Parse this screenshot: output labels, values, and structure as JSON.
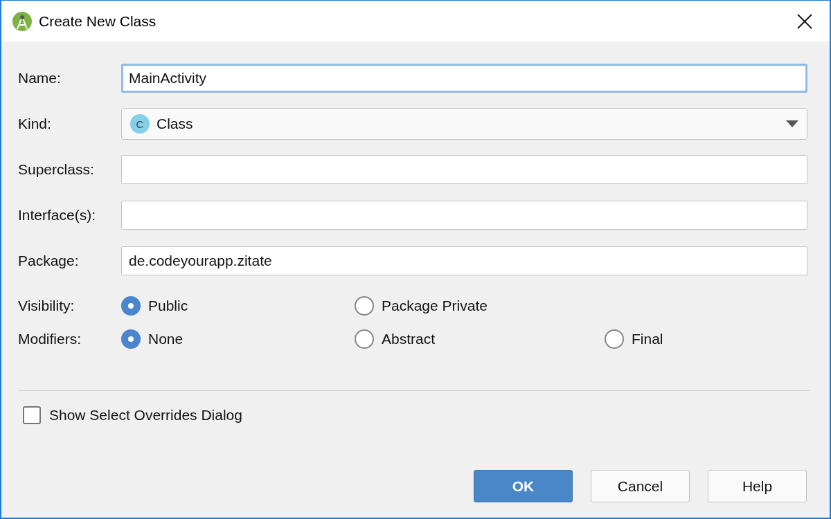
{
  "window": {
    "title": "Create New Class"
  },
  "fields": [
    {
      "kind": "text",
      "label": "Name:",
      "value": "MainActivity",
      "focused": true
    },
    {
      "kind": "dropdown",
      "label": "Kind:",
      "value": "Class",
      "icon_letter": "C"
    },
    {
      "kind": "text",
      "label": "Superclass:",
      "focused": false
    },
    {
      "kind": "text",
      "label": "Interface(s):",
      "focused": false
    },
    {
      "kind": "text",
      "label": "Package:",
      "value": "de.codeyourapp.zitate",
      "focused": false
    }
  ],
  "radio_groups": [
    {
      "label": "Visibility:",
      "options": [
        {
          "label": "Public",
          "selected": true
        },
        {
          "label": "Package Private",
          "selected": false
        }
      ]
    },
    {
      "label": "Modifiers:",
      "options": [
        {
          "label": "None",
          "selected": true
        },
        {
          "label": "Abstract",
          "selected": false
        },
        {
          "label": "Final",
          "selected": false
        }
      ]
    }
  ],
  "checkbox": {
    "label": "Show Select Overrides Dialog",
    "checked": false
  },
  "buttons": [
    {
      "label": "OK",
      "default": true
    },
    {
      "label": "Cancel",
      "default": false
    },
    {
      "label": "Help",
      "default": false
    }
  ]
}
